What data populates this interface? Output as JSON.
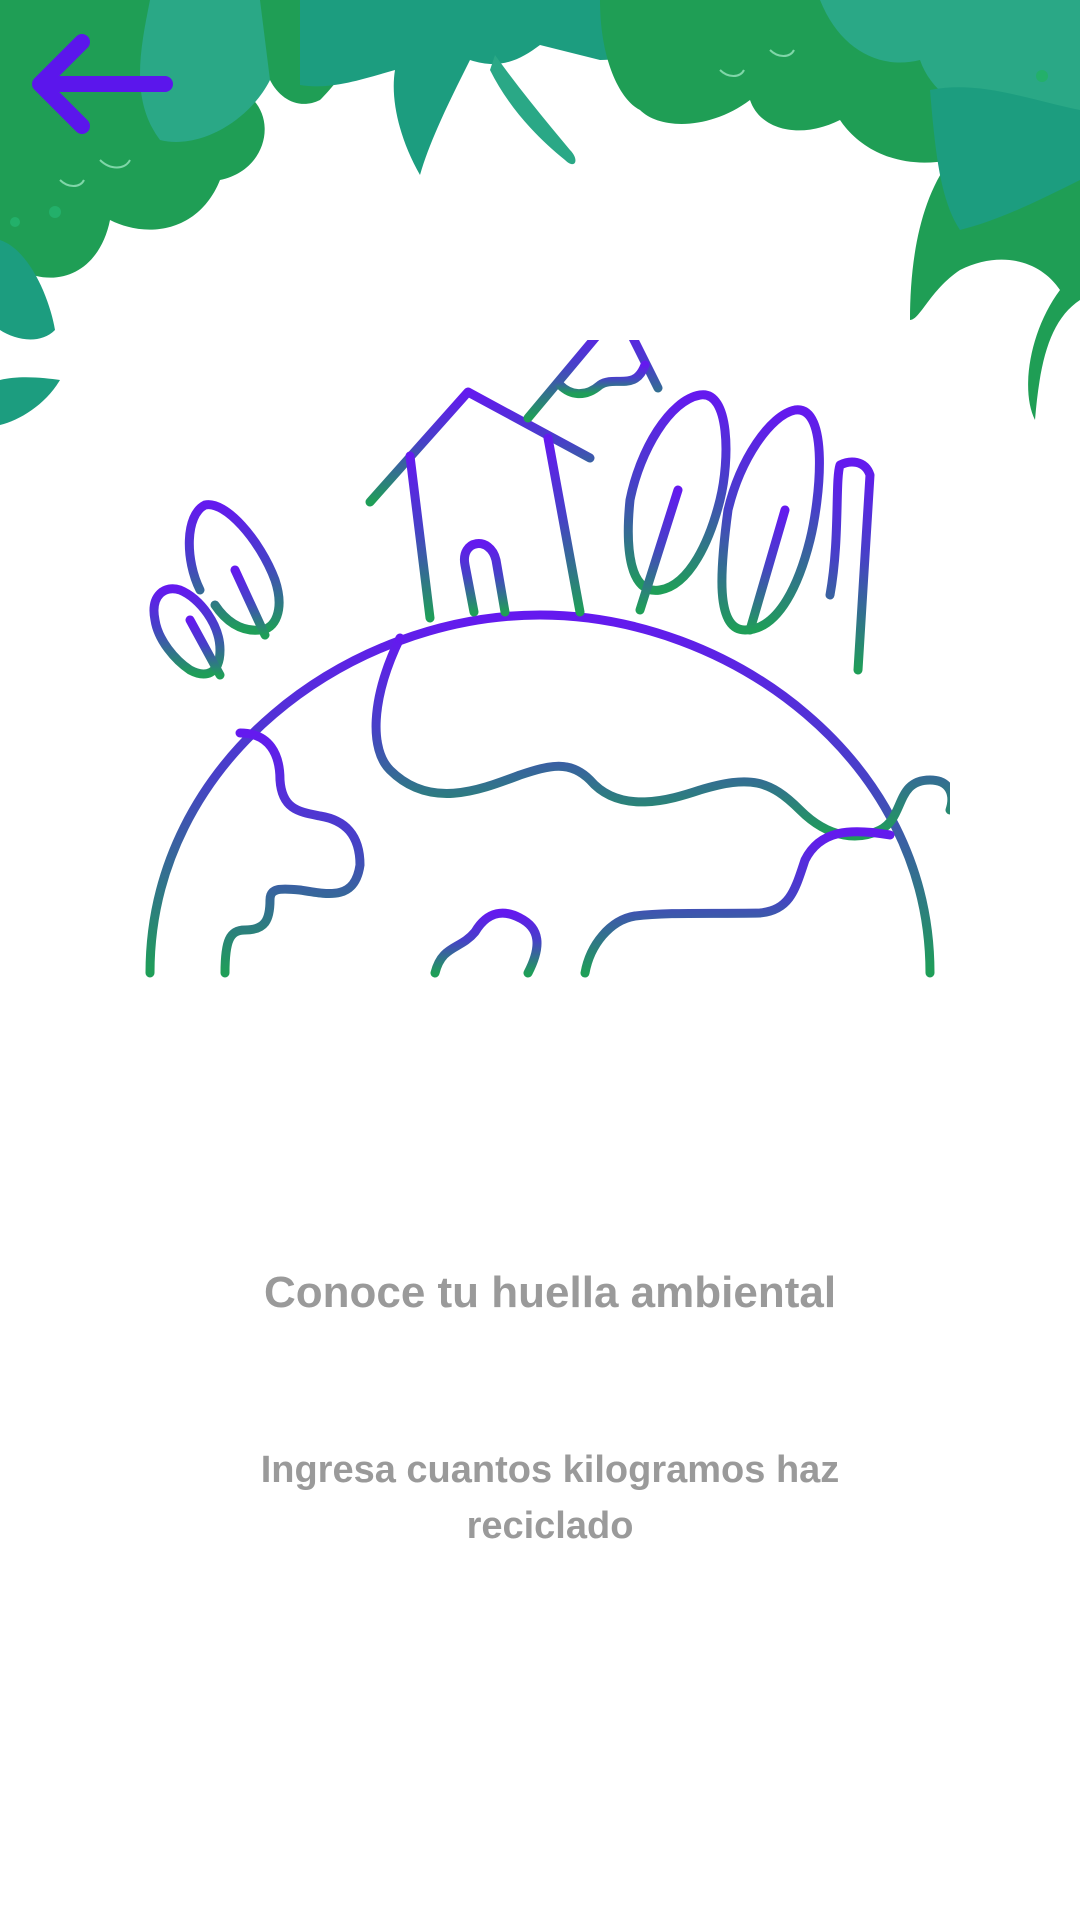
{
  "header": {
    "back_icon": "arrow-left-icon",
    "accent_color": "#5b16ec",
    "foliage_colors": [
      "#1f9e55",
      "#1c9d7f",
      "#2aa886"
    ]
  },
  "hero": {
    "illustration": "earth-house-trees-mountain",
    "gradient_top": "#6419ef",
    "gradient_bottom": "#1f9e58"
  },
  "content": {
    "title": "Conoce tu huella ambiental",
    "subtitle": "Ingresa cuantos kilogramos haz reciclado"
  }
}
